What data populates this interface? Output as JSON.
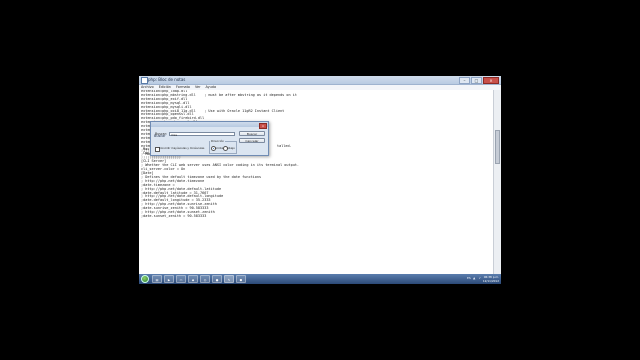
{
  "window": {
    "title": "php: Bloc de notas",
    "controls": {
      "minimize": "–",
      "maximize": "□",
      "close": "×"
    }
  },
  "menu": [
    "Archivo",
    "Edición",
    "Formato",
    "Ver",
    "Ayuda"
  ],
  "editor_lines": [
    "extension=php_ldap.dll",
    "extension=php_mbstring.dll    ; must be after mbstring as it depends on it",
    "extension=php_exif.dll",
    "extension=php_mysql.dll",
    "extension=php_mysqli.dll",
    "extension=php_oci8_11g.dll    ; Use with Oracle 11gR2 Instant Client",
    "extension=php_openssl.dll",
    "extension=php_pdo_firebird.dll",
    "extension=php_pdo_mysql.dll",
    "",
    "",
    "",
    "",
    "",
    "",
    "",
    "",
    "",
    "",
    "",
    "extension=php_soap.dll",
    "extension=php_sockets.dll",
    "extension=php_sqlite3.dll",
    "extension=php_tidy.dll",
    "extension=php_xmlrpc.dll",
    "extension=php_xsl.dll",
    "",
    ";;;;;;;;;;;;;;;;;;;",
    "; Module Settings ;",
    ";;;;;;;;;;;;;;;;;;;",
    "",
    "[CLI Server]",
    "; Whether the CLI web server uses ANSI color coding in its terminal output.",
    "cli_server.color = On",
    "",
    "[Date]",
    "; Defines the default timezone used by the date functions",
    "; http://php.net/date.timezone",
    ";date.timezone =",
    "",
    "; http://php.net/date.default-latitude",
    ";date.default_latitude = 31.7667",
    "",
    "; http://php.net/date.default-longitude",
    ";date.default_longitude = 35.2333",
    "",
    "; http://php.net/date.sunrise-zenith",
    ";date.sunrise_zenith = 90.583333",
    "",
    "; http://php.net/date.sunset-zenith",
    ";date.sunset_zenith = 90.583333"
  ],
  "editor_fragments": {
    "tail_text": "talled.",
    "left_a": "Mac",
    "left_b": "Con"
  },
  "find_dialog": {
    "title": "Buscar",
    "close": "×",
    "find_label": "Buscar:",
    "find_value": "mss",
    "find_next_button": "Buscar siguiente",
    "cancel_button": "Cancelar",
    "match_case_label": "Coincidir mayúsculas y minúsculas",
    "direction_label": "Dirección",
    "direction_up": "Arriba",
    "direction_down": "Abajo"
  },
  "taskbar": {
    "time": "06:38 p.m.",
    "date": "12/11/2012",
    "lang": "ES"
  }
}
